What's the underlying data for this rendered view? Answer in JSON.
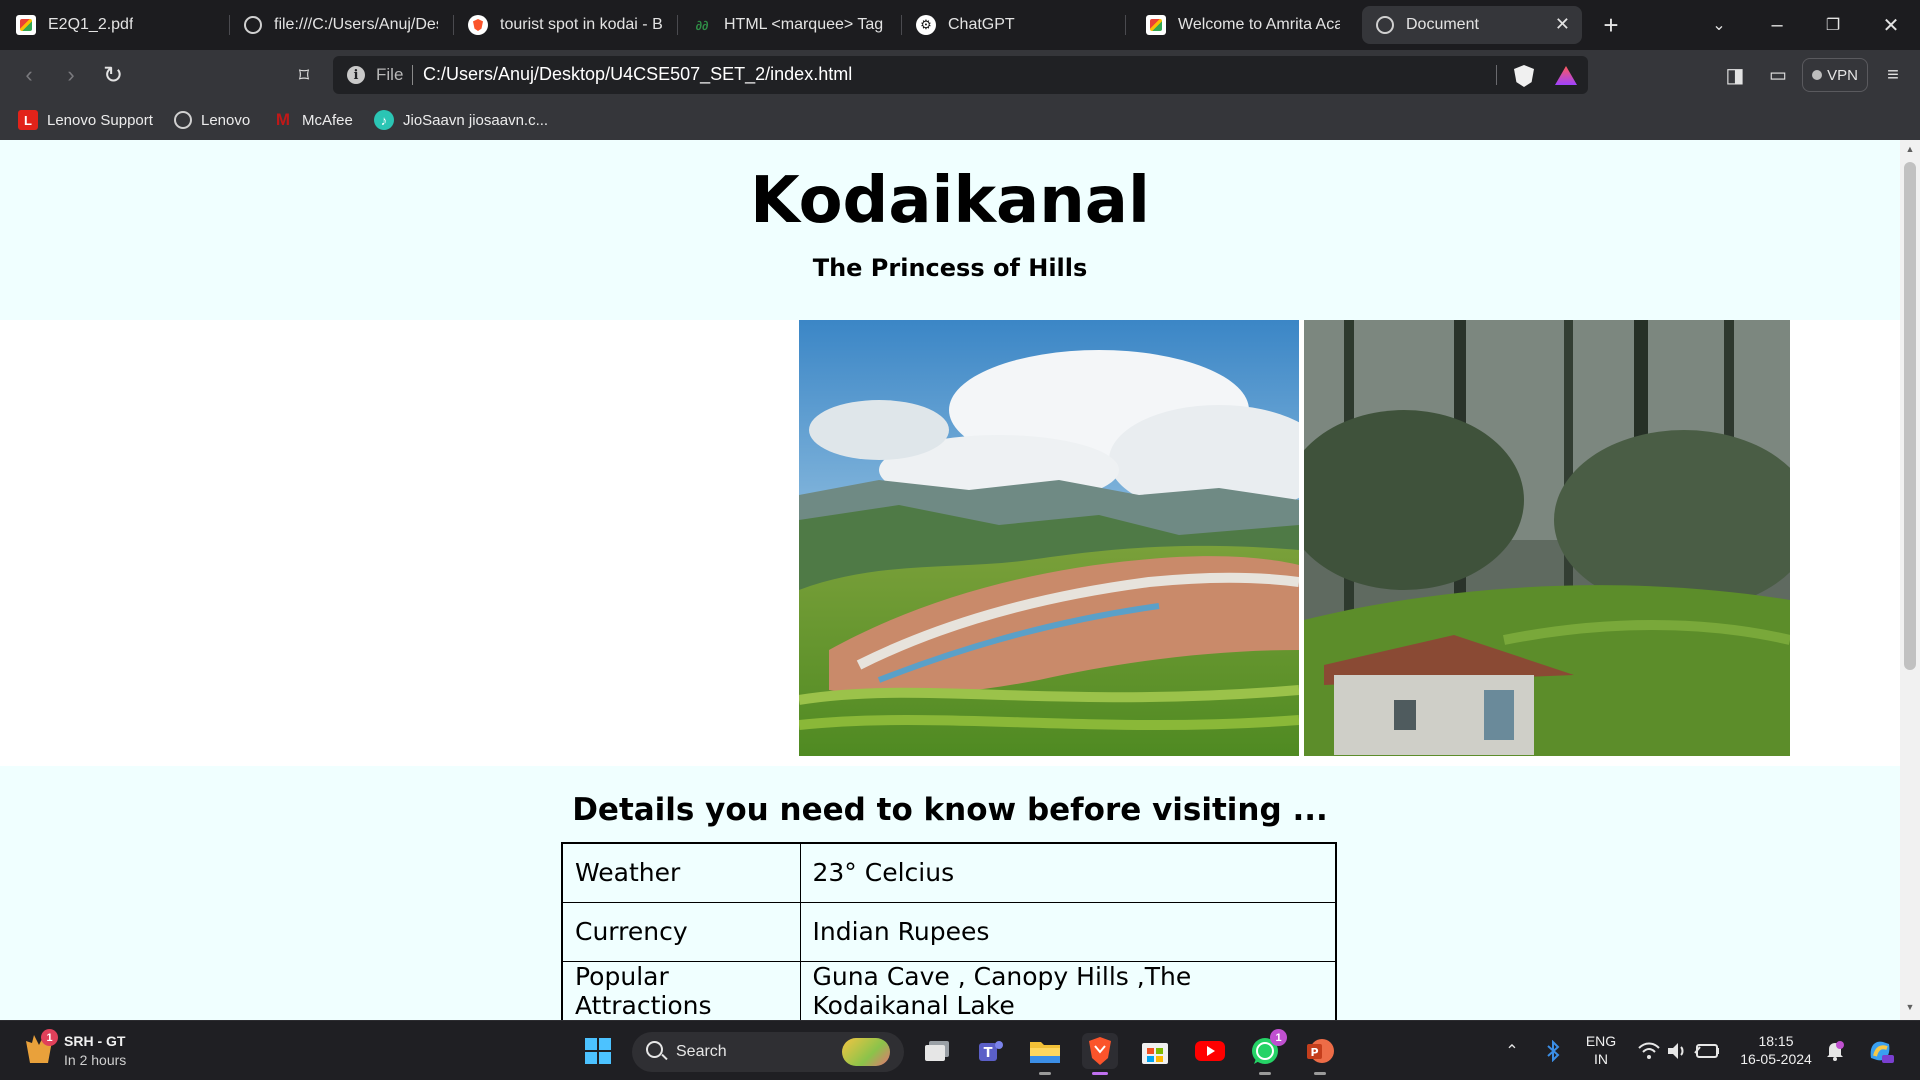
{
  "browser": {
    "tabs": [
      {
        "title": "E2Q1_2.pdf",
        "icon": "pdf-icon"
      },
      {
        "title": "file:///C:/Users/Anuj/Desk",
        "icon": "globe-icon"
      },
      {
        "title": "tourist spot in kodai - Bra",
        "icon": "brave-icon"
      },
      {
        "title": "HTML <marquee> Tag - G",
        "icon": "gfg-icon"
      },
      {
        "title": "ChatGPT",
        "icon": "chatgpt-icon"
      },
      {
        "title": "Welcome to Amrita Acade",
        "icon": "pdf-icon"
      },
      {
        "title": "Document",
        "icon": "globe-icon",
        "active": true
      }
    ],
    "new_tab_glyph": "+",
    "close_tab_glyph": "✕",
    "address": {
      "scheme_label": "File",
      "url": "C:/Users/Anuj/Desktop/U4CSE507_SET_2/index.html"
    },
    "vpn_label": "VPN",
    "bookmarks": [
      {
        "label": "Lenovo Support",
        "icon": "lenovo-icon",
        "glyph": "L",
        "color": "#e2231a"
      },
      {
        "label": "Lenovo",
        "icon": "globe-icon",
        "glyph": "",
        "color": ""
      },
      {
        "label": "McAfee",
        "icon": "mcafee-icon",
        "glyph": "M",
        "color": "#c01818"
      },
      {
        "label": "JioSaavn jiosaavn.c...",
        "icon": "jiosaavn-icon",
        "glyph": "♪",
        "color": "#2bc5b4"
      }
    ]
  },
  "page": {
    "title": "Kodaikanal",
    "subtitle": "The Princess of Hills",
    "details_heading": "Details you need to know before visiting ...",
    "details": [
      {
        "key": "Weather",
        "value": "23° Celcius"
      },
      {
        "key": "Currency",
        "value": "Indian Rupees"
      },
      {
        "key": "Popular Attractions",
        "value": "Guna Cave , Canopy Hills ,The Kodaikanal Lake"
      }
    ],
    "colors": {
      "section_bg": "#f0ffff"
    }
  },
  "taskbar": {
    "weather_widget": {
      "title": "SRH - GT",
      "subtitle": "In 2 hours",
      "badge": "1"
    },
    "search_label": "Search",
    "whatsapp_badge": "1",
    "tray": {
      "lang_top": "ENG",
      "lang_bottom": "IN",
      "time": "18:15",
      "date": "16-05-2024"
    }
  }
}
